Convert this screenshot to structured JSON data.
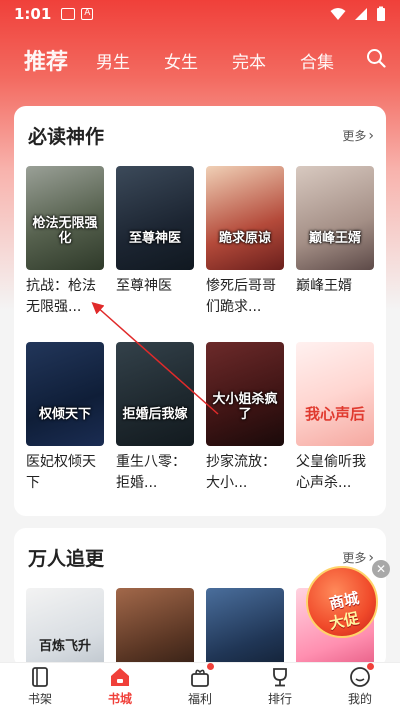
{
  "status_bar": {
    "time": "1:01"
  },
  "tabs": [
    {
      "label": "推荐",
      "active": true
    },
    {
      "label": "男生",
      "active": false
    },
    {
      "label": "女生",
      "active": false
    },
    {
      "label": "完本",
      "active": false
    },
    {
      "label": "合集",
      "active": false
    }
  ],
  "section1": {
    "title": "必读神作",
    "more_label": "更多",
    "books": [
      {
        "title": "抗战：枪法无限强...",
        "cover_text": "枪法无限强化"
      },
      {
        "title": "至尊神医",
        "cover_text": "至尊神医"
      },
      {
        "title": "惨死后哥哥们跪求...",
        "cover_text": "跪求原谅"
      },
      {
        "title": "巅峰王婿",
        "cover_text": "巅峰王婿"
      },
      {
        "title": "医妃权倾天下",
        "cover_text": "权倾天下"
      },
      {
        "title": "重生八零：拒婚...",
        "cover_text": "拒婚后我嫁"
      },
      {
        "title": "抄家流放：大小...",
        "cover_text": "大小姐杀疯了"
      },
      {
        "title": "父皇偷听我心声杀...",
        "cover_text": "我心声后"
      }
    ]
  },
  "section2": {
    "title": "万人追更",
    "more_label": "更多",
    "books": [
      {
        "title": "",
        "cover_text": "百炼飞升"
      },
      {
        "title": "",
        "cover_text": ""
      },
      {
        "title": "",
        "cover_text": ""
      },
      {
        "title": "",
        "cover_text": ""
      }
    ]
  },
  "promo": {
    "line1": "商城",
    "line2": "大促",
    "close": "✕"
  },
  "bottom_nav": [
    {
      "label": "书架",
      "icon": "bookshelf-icon",
      "active": false
    },
    {
      "label": "书城",
      "icon": "bookstore-icon",
      "active": true
    },
    {
      "label": "福利",
      "icon": "gift-icon",
      "active": false
    },
    {
      "label": "排行",
      "icon": "trophy-icon",
      "active": false
    },
    {
      "label": "我的",
      "icon": "profile-icon",
      "active": false
    }
  ],
  "colors": {
    "brand": "#f0403a"
  }
}
